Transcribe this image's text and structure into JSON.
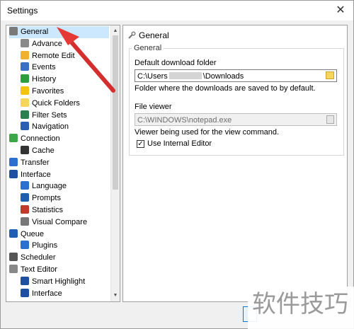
{
  "window": {
    "title": "Settings",
    "close_glyph": "✕"
  },
  "tree": {
    "items": [
      {
        "label": "General",
        "indent": 0,
        "selected": true,
        "icon": "wrench-icon",
        "color": "#7a7a7a"
      },
      {
        "label": "Advance",
        "indent": 1,
        "icon": "gear-icon",
        "color": "#8a8a8a"
      },
      {
        "label": "Remote Edit",
        "indent": 1,
        "icon": "page-edit-icon",
        "color": "#f0b030"
      },
      {
        "label": "Events",
        "indent": 1,
        "icon": "bars-icon",
        "color": "#3a6fc6"
      },
      {
        "label": "History",
        "indent": 1,
        "icon": "history-icon",
        "color": "#2e9d3e"
      },
      {
        "label": "Favorites",
        "indent": 1,
        "icon": "star-icon",
        "color": "#f1c40f"
      },
      {
        "label": "Quick Folders",
        "indent": 1,
        "icon": "folder-icon",
        "color": "#f5d55a"
      },
      {
        "label": "Filter Sets",
        "indent": 1,
        "icon": "filter-icon",
        "color": "#2a7f4f"
      },
      {
        "label": "Navigation",
        "indent": 1,
        "icon": "navigation-icon",
        "color": "#2b5fb4"
      },
      {
        "label": "Connection",
        "indent": 0,
        "icon": "connection-icon",
        "color": "#3aa84a"
      },
      {
        "label": "Cache",
        "indent": 1,
        "icon": "cache-icon",
        "color": "#333333"
      },
      {
        "label": "Transfer",
        "indent": 0,
        "icon": "transfer-icon",
        "color": "#2b6fcf"
      },
      {
        "label": "Interface",
        "indent": 0,
        "icon": "window-icon",
        "color": "#1e4fa0"
      },
      {
        "label": "Language",
        "indent": 1,
        "icon": "language-icon",
        "color": "#2b6fcf"
      },
      {
        "label": "Prompts",
        "indent": 1,
        "icon": "question-icon",
        "color": "#1f5fb0"
      },
      {
        "label": "Statistics",
        "indent": 1,
        "icon": "chart-icon",
        "color": "#c0392b"
      },
      {
        "label": "Visual Compare",
        "indent": 1,
        "icon": "compare-icon",
        "color": "#777777"
      },
      {
        "label": "Queue",
        "indent": 0,
        "icon": "queue-icon",
        "color": "#1e5fb5"
      },
      {
        "label": "Plugins",
        "indent": 1,
        "icon": "puzzle-icon",
        "color": "#2b6fcf"
      },
      {
        "label": "Scheduler",
        "indent": 0,
        "icon": "clock-icon",
        "color": "#555555"
      },
      {
        "label": "Text Editor",
        "indent": 0,
        "icon": "document-icon",
        "color": "#888888"
      },
      {
        "label": "Smart Highlight",
        "indent": 1,
        "icon": "pen-icon",
        "color": "#1f4fa0"
      },
      {
        "label": "Interface",
        "indent": 1,
        "icon": "window-icon",
        "color": "#1e4fa0"
      }
    ]
  },
  "panel": {
    "header": "General",
    "group_title": "General",
    "download_label": "Default download folder",
    "download_prefix": "C:\\Users",
    "download_suffix": "\\Downloads",
    "download_help": "Folder where the downloads are saved to by default.",
    "viewer_label": "File viewer",
    "viewer_value": "C:\\WINDOWS\\notepad.exe",
    "viewer_help": "Viewer being used for the view command.",
    "internal_editor_label": "Use Internal Editor",
    "internal_editor_checked": true,
    "check_glyph": "✓"
  },
  "watermark": "软件技巧",
  "colors": {
    "selection": "#cce8ff",
    "arrow": "#e53935",
    "accent": "#0078d7"
  }
}
